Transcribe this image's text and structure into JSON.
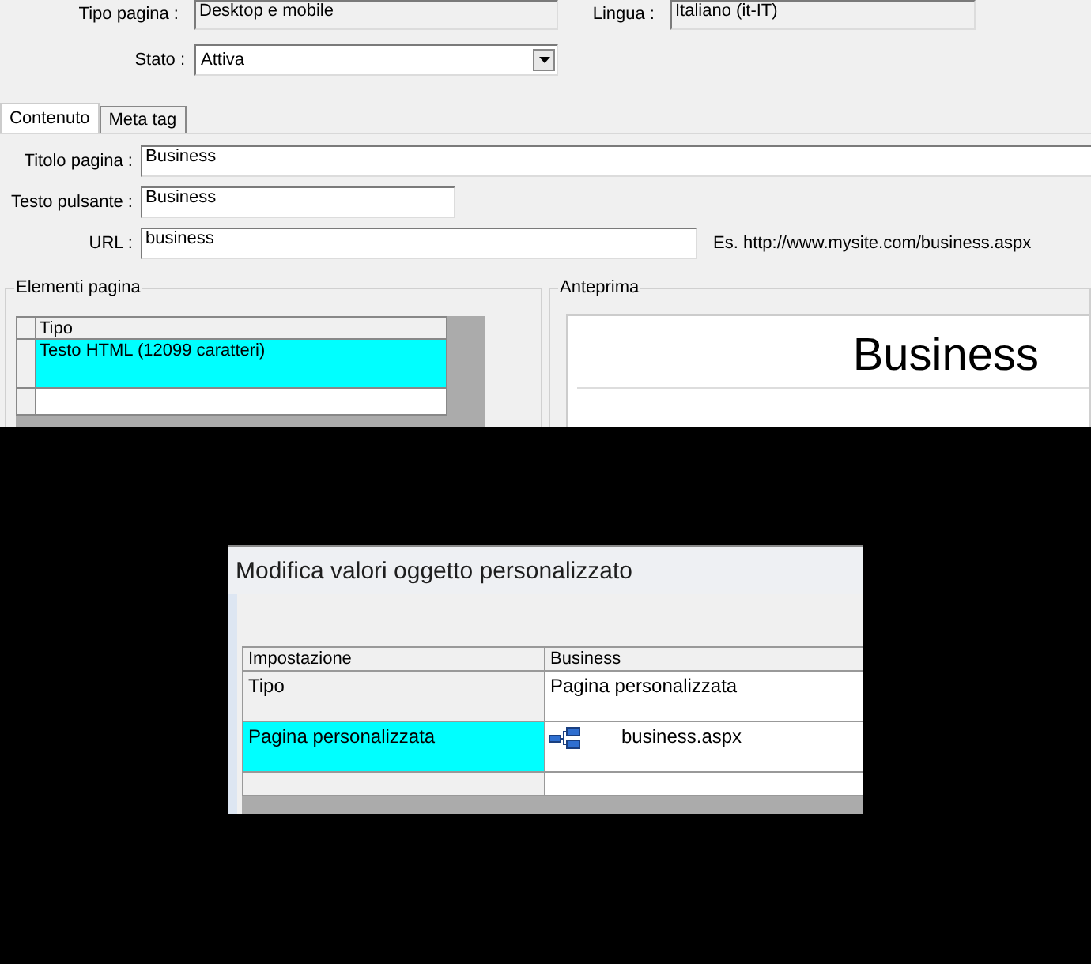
{
  "page_type": {
    "label": "Tipo pagina :",
    "value": "Desktop e mobile"
  },
  "language": {
    "label": "Lingua :",
    "value": "Italiano (it-IT)"
  },
  "status": {
    "label": "Stato :",
    "value": "Attiva"
  },
  "tabs": [
    {
      "label": "Contenuto",
      "selected": true
    },
    {
      "label": "Meta tag",
      "selected": false
    }
  ],
  "content_fields": [
    {
      "label": "Titolo pagina :",
      "value": "Business"
    },
    {
      "label": "Testo pulsante :",
      "value": "Business"
    },
    {
      "label": "URL :",
      "value": "business",
      "hint": "Es. http://www.mysite.com/business.aspx"
    }
  ],
  "page_elements": {
    "title": "Elementi pagina",
    "columns": [
      "Tipo"
    ],
    "rows": [
      {
        "cells": [
          "Testo HTML (12099 caratteri)"
        ],
        "selected": true
      }
    ]
  },
  "preview": {
    "title": "Anteprima",
    "heading": "Business"
  },
  "dialog": {
    "title": "Modifica valori oggetto personalizzato",
    "columns": [
      "Impostazione",
      "Business"
    ],
    "rows": [
      {
        "setting": "Tipo",
        "value": "Pagina personalizzata",
        "kind": "text",
        "selected": false
      },
      {
        "setting": "Pagina personalizzata",
        "value": "business.aspx",
        "kind": "page-link",
        "selected": true
      }
    ]
  }
}
